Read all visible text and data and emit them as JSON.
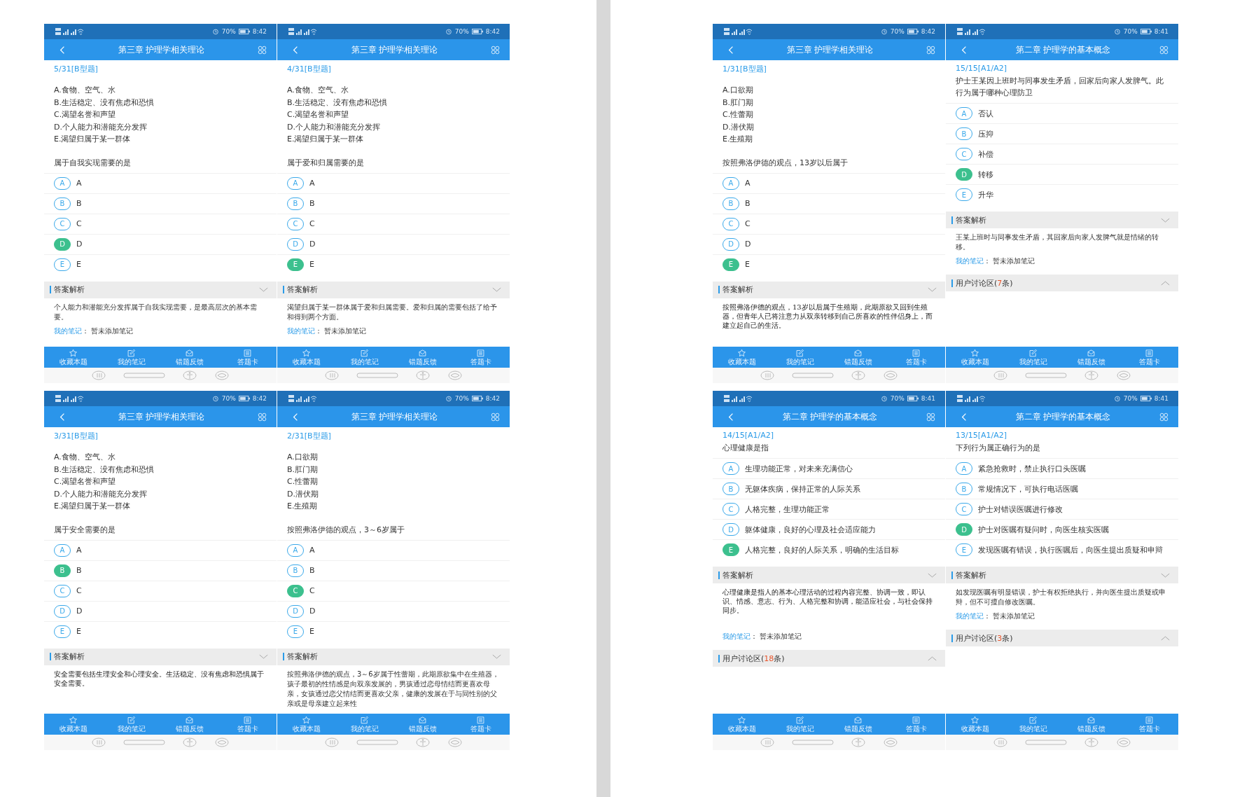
{
  "pages": [
    {
      "phones": [
        {
          "status": {
            "battery": "70%",
            "time": "8:42"
          },
          "title": "第三章 护理学相关理论",
          "number": "5/31[B型题]",
          "list": [
            "A.食物、空气、水",
            "B.生活稳定、没有焦虑和恐惧",
            "C.渴望名誉和声望",
            "D.个人能力和潜能充分发挥",
            "E.渴望归属于某一群体"
          ],
          "question": "属于自我实现需要的是",
          "choices": [
            {
              "letter": "A",
              "text": "A",
              "selected": false
            },
            {
              "letter": "B",
              "text": "B",
              "selected": false
            },
            {
              "letter": "C",
              "text": "C",
              "selected": false
            },
            {
              "letter": "D",
              "text": "D",
              "selected": true
            },
            {
              "letter": "E",
              "text": "E",
              "selected": false
            }
          ],
          "analysis": {
            "heading": "答案解析",
            "text": "个人能力和潜能充分发挥属于自我实现需要，是最高层次的基本需要。",
            "kind": "text"
          },
          "note": {
            "label": "我的笔记",
            "value": "： 暂未添加笔记"
          },
          "tabs": [
            {
              "kind": "star",
              "label": "收藏本题"
            },
            {
              "kind": "edit",
              "label": "我的笔记"
            },
            {
              "kind": "mail",
              "label": "错题反馈"
            },
            {
              "kind": "card",
              "label": "答题卡"
            }
          ]
        },
        {
          "status": {
            "battery": "70%",
            "time": "8:42"
          },
          "title": "第三章 护理学相关理论",
          "number": "4/31[B型题]",
          "list": [
            "A.食物、空气、水",
            "B.生活稳定、没有焦虑和恐惧",
            "C.渴望名誉和声望",
            "D.个人能力和潜能充分发挥",
            "E.渴望归属于某一群体"
          ],
          "question": "属于爱和归属需要的是",
          "choices": [
            {
              "letter": "A",
              "text": "A",
              "selected": false
            },
            {
              "letter": "B",
              "text": "B",
              "selected": false
            },
            {
              "letter": "C",
              "text": "C",
              "selected": false
            },
            {
              "letter": "D",
              "text": "D",
              "selected": false
            },
            {
              "letter": "E",
              "text": "E",
              "selected": true
            }
          ],
          "analysis": {
            "heading": "答案解析",
            "text": "渴望归属于某一群体属于爱和归属需要。爱和归属的需要包括了给予和得到两个方面。",
            "kind": "text"
          },
          "note": {
            "label": "我的笔记",
            "value": "： 暂未添加笔记"
          },
          "tabs": [
            {
              "kind": "star",
              "label": "收藏本题"
            },
            {
              "kind": "edit",
              "label": "我的笔记"
            },
            {
              "kind": "mail",
              "label": "错题反馈"
            },
            {
              "kind": "card",
              "label": "答题卡"
            }
          ]
        },
        {
          "status": {
            "battery": "70%",
            "time": "8:42"
          },
          "title": "第三章 护理学相关理论",
          "number": "3/31[B型题]",
          "list": [
            "A.食物、空气、水",
            "B.生活稳定、没有焦虑和恐惧",
            "C.渴望名誉和声望",
            "D.个人能力和潜能充分发挥",
            "E.渴望归属于某一群体"
          ],
          "question": "属于安全需要的是",
          "choices": [
            {
              "letter": "A",
              "text": "A",
              "selected": false
            },
            {
              "letter": "B",
              "text": "B",
              "selected": true
            },
            {
              "letter": "C",
              "text": "C",
              "selected": false
            },
            {
              "letter": "D",
              "text": "D",
              "selected": false
            },
            {
              "letter": "E",
              "text": "E",
              "selected": false
            }
          ],
          "analysis": {
            "heading": "答案解析",
            "text": "安全需要包括生理安全和心理安全。生活稳定、没有焦虑和恐惧属于安全需要。",
            "kind": "scan"
          },
          "tabs": [
            {
              "kind": "star",
              "label": "收藏本题"
            },
            {
              "kind": "edit",
              "label": "我的笔记"
            },
            {
              "kind": "mail",
              "label": "错题反馈"
            },
            {
              "kind": "card",
              "label": "答题卡"
            }
          ]
        },
        {
          "status": {
            "battery": "70%",
            "time": "8:42"
          },
          "title": "第三章 护理学相关理论",
          "number": "2/31[B型题]",
          "list": [
            "A.口欲期",
            "B.肛门期",
            "C.性蕾期",
            "D.潜伏期",
            "E.生殖期"
          ],
          "question": "按照弗洛伊德的观点，3～6岁属于",
          "choices": [
            {
              "letter": "A",
              "text": "A",
              "selected": false
            },
            {
              "letter": "B",
              "text": "B",
              "selected": false
            },
            {
              "letter": "C",
              "text": "C",
              "selected": true
            },
            {
              "letter": "D",
              "text": "D",
              "selected": false
            },
            {
              "letter": "E",
              "text": "E",
              "selected": false
            }
          ],
          "analysis": {
            "heading": "答案解析",
            "text": "按照弗洛伊德的观点，3～6岁属于性蕾期，此期原欲集中在生殖器，孩子最初的性情感是向双亲发展的，男孩通过恋母情结而更喜欢母亲，女孩通过恋父情结而更喜欢父亲，健康的发展在于与同性别的父亲或是母亲建立起来性",
            "kind": "text"
          },
          "tabs": [
            {
              "kind": "star",
              "label": "收藏本题"
            },
            {
              "kind": "edit",
              "label": "我的笔记"
            },
            {
              "kind": "mail",
              "label": "错题反馈"
            },
            {
              "kind": "card",
              "label": "答题卡"
            }
          ]
        }
      ]
    },
    {
      "phones": [
        {
          "status": {
            "battery": "70%",
            "time": "8:42"
          },
          "title": "第三章 护理学相关理论",
          "number": "1/31[B型题]",
          "list": [
            "A.口欲期",
            "B.肛门期",
            "C.性蕾期",
            "D.潜伏期",
            "E.生殖期"
          ],
          "question": "按照弗洛伊德的观点，13岁以后属于",
          "choices": [
            {
              "letter": "A",
              "text": "A",
              "selected": false
            },
            {
              "letter": "B",
              "text": "B",
              "selected": false
            },
            {
              "letter": "C",
              "text": "C",
              "selected": false
            },
            {
              "letter": "D",
              "text": "D",
              "selected": false
            },
            {
              "letter": "E",
              "text": "E",
              "selected": true
            }
          ],
          "analysis": {
            "heading": "答案解析",
            "text": "按照弗洛伊德的观点，13岁以后属于生殖期，此期原欲又回到生殖器，但青年人已将注意力从双亲转移到自己所喜欢的性伴侣身上，而建立起自己的生活。",
            "kind": "scan"
          },
          "tabs": [
            {
              "kind": "star",
              "label": "收藏本题"
            },
            {
              "kind": "edit",
              "label": "我的笔记"
            },
            {
              "kind": "mail",
              "label": "错题反馈"
            },
            {
              "kind": "card",
              "label": "答题卡"
            }
          ]
        },
        {
          "status": {
            "battery": "70%",
            "time": "8:41"
          },
          "title": "第二章 护理学的基本概念",
          "number": "15/15[A1/A2]",
          "question": "护士王某因上班时与同事发生矛盾，回家后向家人发脾气。此行为属于哪种心理防卫",
          "choices": [
            {
              "letter": "A",
              "text": "否认",
              "selected": false
            },
            {
              "letter": "B",
              "text": "压抑",
              "selected": false
            },
            {
              "letter": "C",
              "text": "补偿",
              "selected": false
            },
            {
              "letter": "D",
              "text": "转移",
              "selected": true
            },
            {
              "letter": "E",
              "text": "升华",
              "selected": false
            }
          ],
          "analysis": {
            "heading": "答案解析",
            "text": "王某上班时与同事发生矛盾，其回家后向家人发脾气就是情绪的转移。",
            "kind": "text"
          },
          "note": {
            "label": "我的笔记",
            "value": "： 暂未添加笔记"
          },
          "discussion": {
            "prefix": "用户讨论区(",
            "count": "7",
            "suffix": "条)"
          },
          "tabs": [
            {
              "kind": "star",
              "label": "收藏本题"
            },
            {
              "kind": "edit",
              "label": "我的笔记"
            },
            {
              "kind": "mail",
              "label": "错题反馈"
            },
            {
              "kind": "card",
              "label": "答题卡"
            }
          ]
        },
        {
          "status": {
            "battery": "70%",
            "time": "8:41"
          },
          "title": "第二章 护理学的基本概念",
          "number": "14/15[A1/A2]",
          "question": "心理健康是指",
          "choices": [
            {
              "letter": "A",
              "text": "生理功能正常，对未来充满信心",
              "selected": false
            },
            {
              "letter": "B",
              "text": "无躯体疾病，保持正常的人际关系",
              "selected": false
            },
            {
              "letter": "C",
              "text": "人格完整，生理功能正常",
              "selected": false
            },
            {
              "letter": "D",
              "text": "躯体健康，良好的心理及社会适应能力",
              "selected": false
            },
            {
              "letter": "E",
              "text": "人格完整，良好的人际关系，明确的生活目标",
              "selected": true
            }
          ],
          "analysis": {
            "heading": "答案解析",
            "text": "心理健康是指人的基本心理活动的过程内容完整、协调一致，即认识、情感、意志、行为、人格完整和协调，能适应社会，与社会保持同步。",
            "kind": "scan"
          },
          "note": {
            "label": "我的笔记",
            "value": "： 暂未添加笔记"
          },
          "discussion": {
            "prefix": "用户讨论区(",
            "count": "18",
            "suffix": "条)"
          },
          "tabs": [
            {
              "kind": "star",
              "label": "收藏本题"
            },
            {
              "kind": "edit",
              "label": "我的笔记"
            },
            {
              "kind": "mail",
              "label": "错题反馈"
            },
            {
              "kind": "card",
              "label": "答题卡"
            }
          ]
        },
        {
          "status": {
            "battery": "70%",
            "time": "8:41"
          },
          "title": "第二章 护理学的基本概念",
          "number": "13/15[A1/A2]",
          "question": "下列行为属正确行为的是",
          "choices": [
            {
              "letter": "A",
              "text": "紧急抢救时，禁止执行口头医嘱",
              "selected": false
            },
            {
              "letter": "B",
              "text": "常规情况下，可执行电话医嘱",
              "selected": false
            },
            {
              "letter": "C",
              "text": "护士对错误医嘱进行修改",
              "selected": false
            },
            {
              "letter": "D",
              "text": "护士对医嘱有疑问时，向医生核实医嘱",
              "selected": true
            },
            {
              "letter": "E",
              "text": "发现医嘱有错误，执行医嘱后，向医生提出质疑和申辩",
              "selected": false
            }
          ],
          "analysis": {
            "heading": "答案解析",
            "text": "如发现医嘱有明显错误，护士有权拒绝执行，并向医生提出质疑或申辩，但不可擅自修改医嘱。",
            "kind": "text"
          },
          "note": {
            "label": "我的笔记",
            "value": "： 暂未添加笔记"
          },
          "discussion": {
            "prefix": "用户讨论区(",
            "count": "3",
            "suffix": "条)"
          },
          "tabs": [
            {
              "kind": "star",
              "label": "收藏本题"
            },
            {
              "kind": "edit",
              "label": "我的笔记"
            },
            {
              "kind": "mail",
              "label": "错题反馈"
            },
            {
              "kind": "card",
              "label": "答题卡"
            }
          ]
        }
      ]
    }
  ]
}
